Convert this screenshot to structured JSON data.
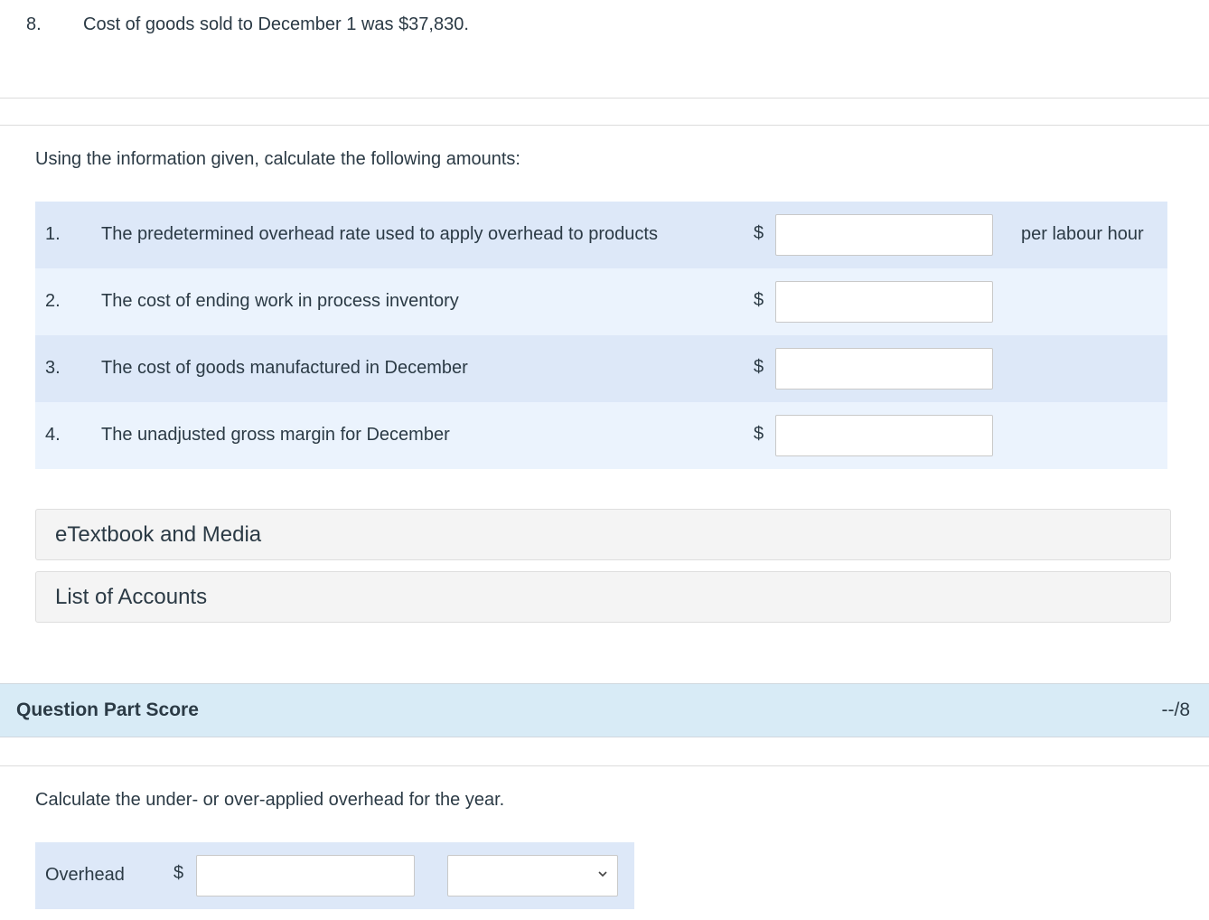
{
  "top_item": {
    "number": "8.",
    "text": "Cost of goods sold to December 1 was $37,830."
  },
  "part1": {
    "instruction": "Using the information given, calculate the following amounts:",
    "questions": [
      {
        "number": "1.",
        "label": "The predetermined overhead rate used to apply overhead to products",
        "currency": "$",
        "value": "",
        "unit": "per labour hour"
      },
      {
        "number": "2.",
        "label": "The cost of ending work in process inventory",
        "currency": "$",
        "value": "",
        "unit": ""
      },
      {
        "number": "3.",
        "label": "The cost of goods manufactured in December",
        "currency": "$",
        "value": "",
        "unit": ""
      },
      {
        "number": "4.",
        "label": "The unadjusted gross margin for December",
        "currency": "$",
        "value": "",
        "unit": ""
      }
    ],
    "resources": [
      {
        "label": "eTextbook and Media"
      },
      {
        "label": "List of Accounts"
      }
    ]
  },
  "score": {
    "title": "Question Part Score",
    "value": "--/8"
  },
  "part2": {
    "instruction": "Calculate the under- or over-applied overhead for the year.",
    "row": {
      "label": "Overhead",
      "currency": "$",
      "value": "",
      "select_value": ""
    }
  },
  "colors": {
    "row_dark": "#dde8f8",
    "row_light": "#ebf3fd",
    "score_bar": "#d8ebf6",
    "text": "#2b3a45"
  }
}
